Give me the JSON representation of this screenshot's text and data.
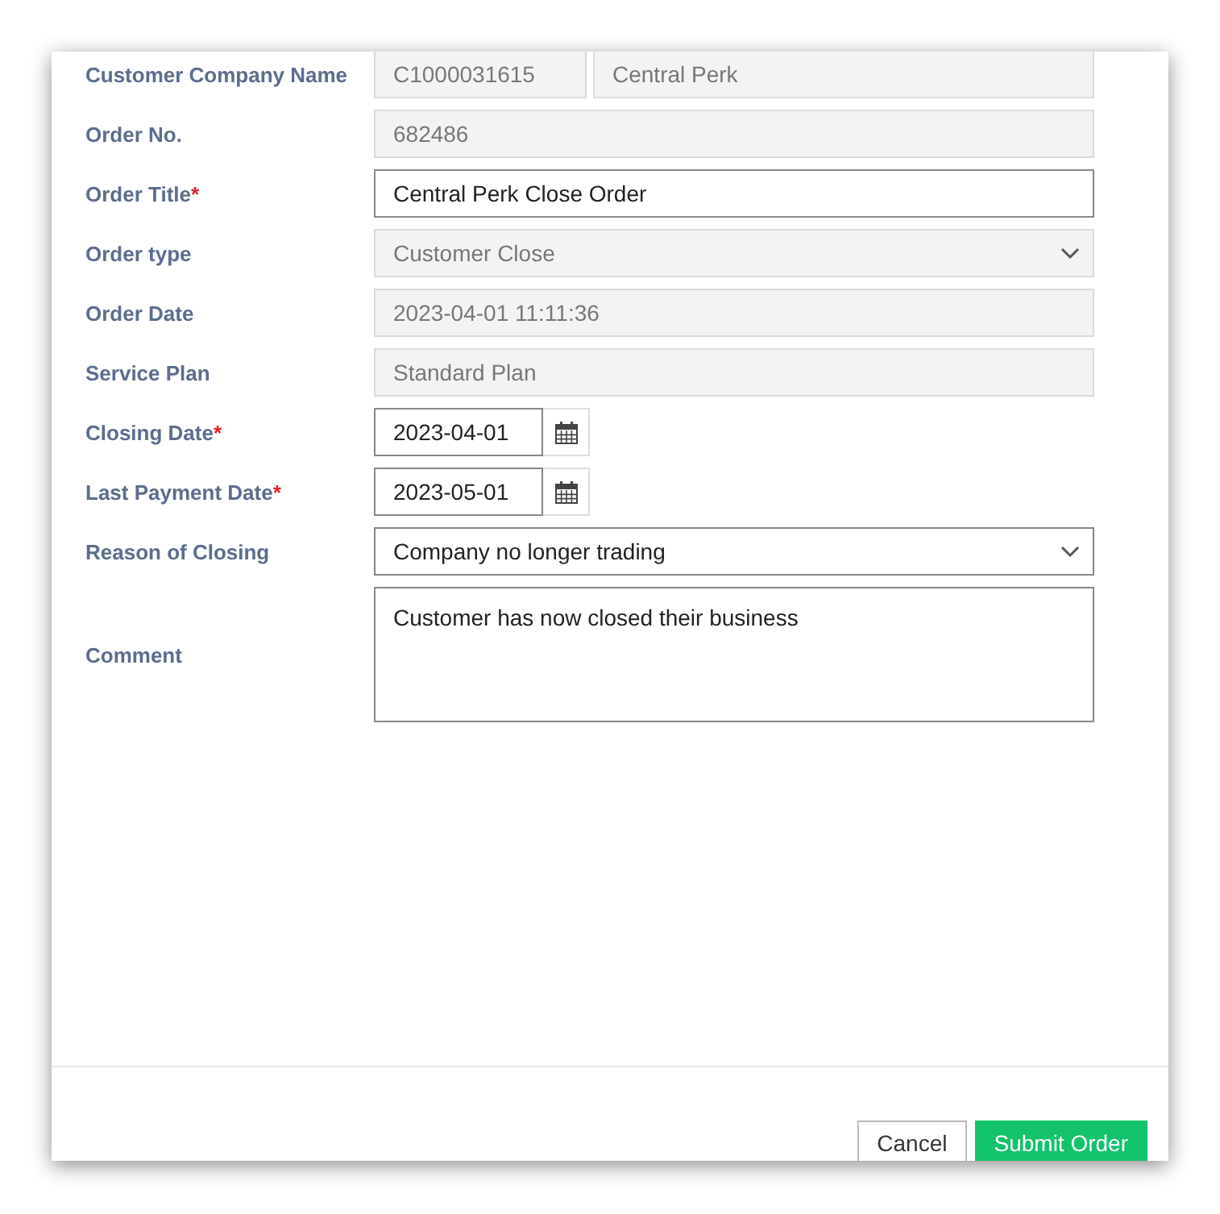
{
  "fields": [
    {
      "label": "Customer Company Name",
      "kind": "pair",
      "required": false,
      "disabled": true,
      "values": [
        "C1000031615",
        "Central Perk"
      ]
    },
    {
      "label": "Order No.",
      "kind": "text",
      "required": false,
      "disabled": true,
      "value": "682486"
    },
    {
      "label": "Order Title",
      "kind": "text",
      "required": true,
      "disabled": false,
      "value": "Central Perk Close Order"
    },
    {
      "label": "Order type",
      "kind": "select",
      "required": false,
      "disabled": true,
      "value": "Customer Close"
    },
    {
      "label": "Order Date",
      "kind": "text",
      "required": false,
      "disabled": true,
      "value": "2023-04-01 11:11:36"
    },
    {
      "label": "Service Plan",
      "kind": "text",
      "required": false,
      "disabled": true,
      "value": "Standard Plan"
    },
    {
      "label": "Closing Date",
      "kind": "date",
      "required": true,
      "disabled": false,
      "value": "2023-04-01"
    },
    {
      "label": "Last Payment Date",
      "kind": "date",
      "required": true,
      "disabled": false,
      "value": "2023-05-01"
    },
    {
      "label": "Reason of Closing",
      "kind": "select",
      "required": false,
      "disabled": false,
      "value": "Company no longer trading"
    },
    {
      "label": "Comment",
      "kind": "textarea",
      "required": false,
      "disabled": false,
      "value": "Customer has now closed their business"
    }
  ],
  "required_mark": "*",
  "buttons": [
    {
      "label": "Cancel",
      "kind": "secondary"
    },
    {
      "label": "Submit Order",
      "kind": "primary"
    }
  ]
}
